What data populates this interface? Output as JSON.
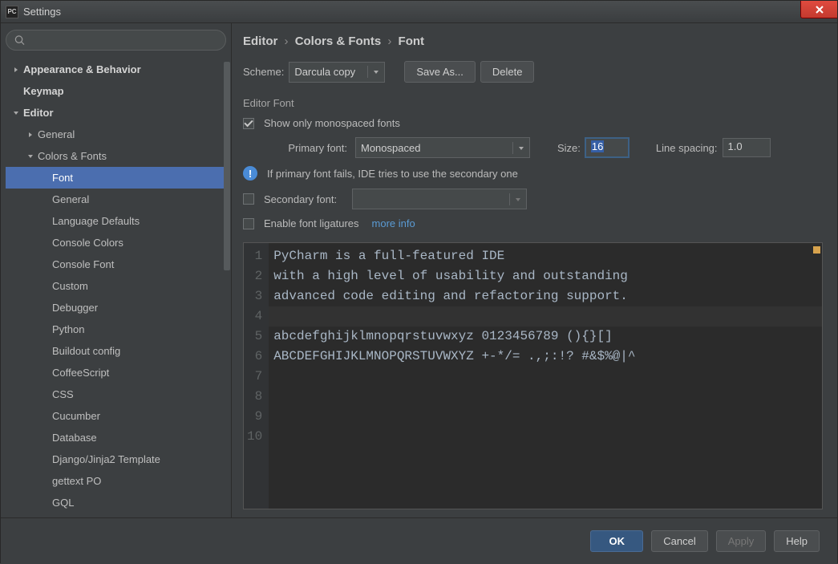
{
  "window": {
    "title": "Settings"
  },
  "sidebar": {
    "search_placeholder": "",
    "items": [
      {
        "label": "Appearance & Behavior",
        "level": 0,
        "bold": true,
        "arrow": "right"
      },
      {
        "label": "Keymap",
        "level": 0,
        "bold": true
      },
      {
        "label": "Editor",
        "level": 0,
        "bold": true,
        "arrow": "down"
      },
      {
        "label": "General",
        "level": 1,
        "arrow": "right"
      },
      {
        "label": "Colors & Fonts",
        "level": 1,
        "arrow": "down"
      },
      {
        "label": "Font",
        "level": 2,
        "selected": true
      },
      {
        "label": "General",
        "level": 2
      },
      {
        "label": "Language Defaults",
        "level": 2
      },
      {
        "label": "Console Colors",
        "level": 2
      },
      {
        "label": "Console Font",
        "level": 2
      },
      {
        "label": "Custom",
        "level": 2
      },
      {
        "label": "Debugger",
        "level": 2
      },
      {
        "label": "Python",
        "level": 2
      },
      {
        "label": "Buildout config",
        "level": 2
      },
      {
        "label": "CoffeeScript",
        "level": 2
      },
      {
        "label": "CSS",
        "level": 2
      },
      {
        "label": "Cucumber",
        "level": 2
      },
      {
        "label": "Database",
        "level": 2
      },
      {
        "label": "Django/Jinja2 Template",
        "level": 2
      },
      {
        "label": "gettext PO",
        "level": 2
      },
      {
        "label": "GQL",
        "level": 2
      }
    ]
  },
  "breadcrumb": [
    "Editor",
    "Colors & Fonts",
    "Font"
  ],
  "scheme": {
    "label": "Scheme:",
    "value": "Darcula copy",
    "save_as": "Save As...",
    "delete": "Delete"
  },
  "editor_font": {
    "section": "Editor Font",
    "monospaced_label": "Show only monospaced fonts",
    "monospaced_checked": true,
    "primary_label": "Primary font:",
    "primary_value": "Monospaced",
    "size_label": "Size:",
    "size_value": "16",
    "line_spacing_label": "Line spacing:",
    "line_spacing_value": "1.0",
    "hint": "If primary font fails, IDE tries to use the secondary one",
    "secondary_label": "Secondary font:",
    "secondary_value": "",
    "ligatures_label": "Enable font ligatures",
    "ligatures_checked": false,
    "more_info": "more info"
  },
  "preview": {
    "lines": [
      "PyCharm is a full-featured IDE",
      "with a high level of usability and outstanding",
      "advanced code editing and refactoring support.",
      "",
      "abcdefghijklmnopqrstuvwxyz 0123456789 (){}[]",
      "ABCDEFGHIJKLMNOPQRSTUVWXYZ +-*/= .,;:!? #&$%@|^",
      "",
      "",
      "",
      ""
    ],
    "current_line": 4
  },
  "footer": {
    "ok": "OK",
    "cancel": "Cancel",
    "apply": "Apply",
    "help": "Help"
  }
}
